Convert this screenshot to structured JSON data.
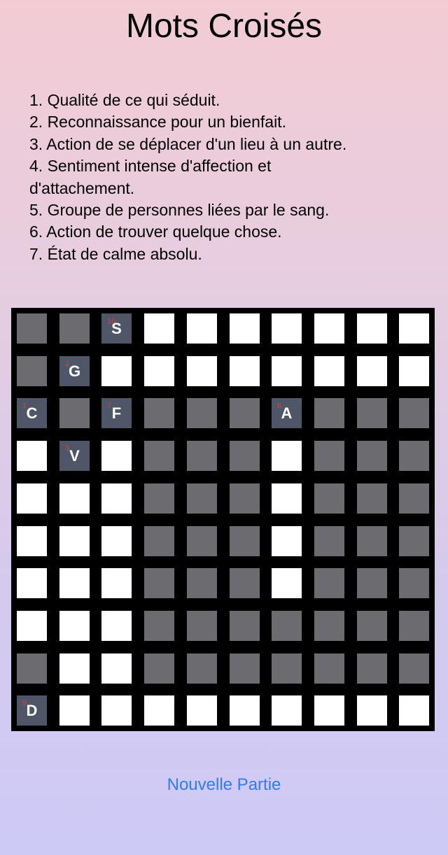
{
  "title": "Mots Croisés",
  "clues": [
    "1. Qualité de ce qui séduit.",
    "2. Reconnaissance pour un bienfait.",
    "3. Action de se déplacer d'un lieu à un autre.",
    "4. Sentiment intense d'affection et",
    "d'attachement.",
    "5. Groupe de personnes liées par le sang.",
    "6. Action de trouver quelque chose.",
    "7. État de calme absolu."
  ],
  "grid": {
    "rows": [
      [
        "b",
        "b",
        "g",
        "w",
        "w",
        "w",
        "w",
        "w",
        "w",
        "w"
      ],
      [
        "b",
        "g",
        "w",
        "w",
        "w",
        "w",
        "w",
        "w",
        "w",
        "w"
      ],
      [
        "g",
        "b",
        "g",
        "b",
        "b",
        "b",
        "g",
        "b",
        "b",
        "b"
      ],
      [
        "w",
        "g",
        "w",
        "b",
        "b",
        "b",
        "w",
        "b",
        "b",
        "b"
      ],
      [
        "w",
        "w",
        "w",
        "b",
        "b",
        "b",
        "w",
        "b",
        "b",
        "b"
      ],
      [
        "w",
        "w",
        "w",
        "b",
        "b",
        "b",
        "w",
        "b",
        "b",
        "b"
      ],
      [
        "w",
        "w",
        "w",
        "b",
        "b",
        "b",
        "w",
        "b",
        "b",
        "b"
      ],
      [
        "w",
        "w",
        "w",
        "b",
        "b",
        "b",
        "b",
        "b",
        "b",
        "b"
      ],
      [
        "b",
        "w",
        "w",
        "b",
        "b",
        "b",
        "b",
        "b",
        "b",
        "b"
      ],
      [
        "g",
        "w",
        "w",
        "w",
        "w",
        "w",
        "w",
        "w",
        "w",
        "w"
      ]
    ],
    "given": [
      {
        "row": 0,
        "col": 2,
        "num": "10",
        "letter": "S"
      },
      {
        "row": 1,
        "col": 1,
        "num": "2",
        "letter": "G"
      },
      {
        "row": 2,
        "col": 0,
        "num": "1",
        "letter": "C"
      },
      {
        "row": 2,
        "col": 2,
        "num": "7",
        "letter": "F"
      },
      {
        "row": 2,
        "col": 6,
        "num": "6",
        "letter": "A"
      },
      {
        "row": 3,
        "col": 1,
        "num": "3",
        "letter": "V"
      },
      {
        "row": 9,
        "col": 0,
        "num": "9",
        "letter": "D"
      }
    ]
  },
  "colors": {
    "white_cell": "#ffffff",
    "black_cell": "#6b6b70",
    "given_cell": "#4f5668",
    "number": "#e03c3c",
    "button": "#2f7df6"
  },
  "button": {
    "label": "Nouvelle Partie"
  }
}
